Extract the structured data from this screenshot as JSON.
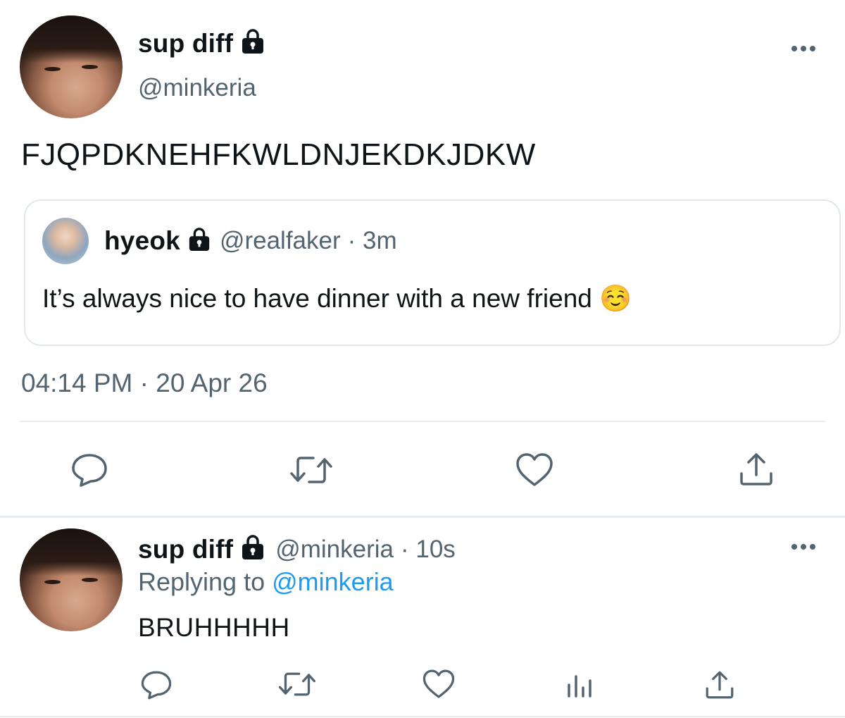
{
  "tweet": {
    "author_name": "sup diff",
    "author_handle": "@minkeria",
    "text": "FJQPDKNEHFKWLDNJEKDKJDKW",
    "timestamp": "04:14 PM · 20 Apr 26",
    "quote": {
      "author_name": "hyeok",
      "author_handle": "@realfaker",
      "age": "· 3m",
      "text": "It’s always nice to have dinner with a new friend ☺️"
    }
  },
  "reply": {
    "author_name": "sup diff",
    "author_handle": "@minkeria",
    "age": "· 10s",
    "replying_prefix": "Replying to",
    "replying_to": "@minkeria",
    "text": "BRUHHHHH"
  },
  "icons": {
    "lock": "lock-icon",
    "more": "more-icon",
    "reply": "reply-icon",
    "retweet": "retweet-icon",
    "like": "heart-icon",
    "share": "share-icon",
    "analytics": "analytics-icon"
  },
  "colors": {
    "text": "#0f1419",
    "secondary": "#536471",
    "link": "#1d9bf0",
    "border": "#e1e8ed"
  }
}
